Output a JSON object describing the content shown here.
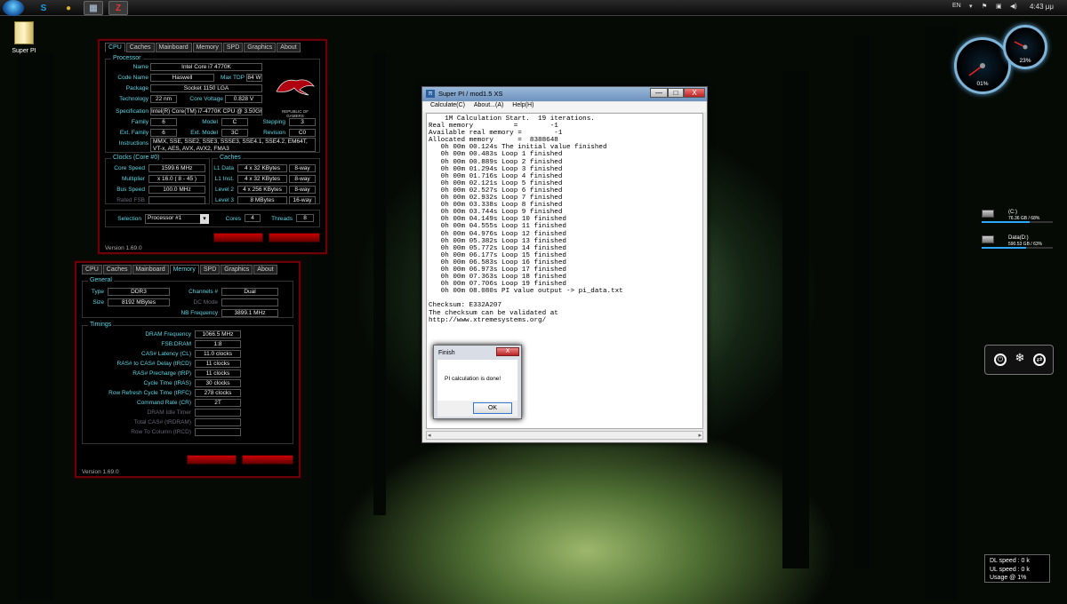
{
  "taskbar": {
    "lang": "EN",
    "clock": "4:43 μμ",
    "apps": [
      {
        "icon": "skype-icon",
        "glyph": "S",
        "color": "#1ba1e2"
      },
      {
        "icon": "chrome-icon",
        "glyph": "●",
        "color": "#e0b020"
      },
      {
        "icon": "cpuid-icon",
        "glyph": "▦",
        "color": "#9ab"
      },
      {
        "icon": "z-icon",
        "glyph": "Z",
        "color": "#e33"
      }
    ]
  },
  "desktop": {
    "icon_label": "Super PI"
  },
  "cpuz1": {
    "tabs": [
      "CPU",
      "Caches",
      "Mainboard",
      "Memory",
      "SPD",
      "Graphics",
      "About"
    ],
    "processor_title": "Processor",
    "name_label": "Name",
    "name": "Intel Core i7 4770K",
    "codename_label": "Code Name",
    "codename": "Haswell",
    "maxtdp_label": "Max TDP",
    "maxtdp": "84 W",
    "package_label": "Package",
    "package": "Socket 1150 LGA",
    "tech_label": "Technology",
    "tech": "22 nm",
    "voltage_label": "Core Voltage",
    "voltage": "0.828 V",
    "spec_label": "Specification",
    "spec": "Intel(R) Core(TM) i7-4770K CPU @ 3.50GHz",
    "family_label": "Family",
    "family": "6",
    "model_label": "Model",
    "model": "C",
    "stepping_label": "Stepping",
    "stepping": "3",
    "extfamily_label": "Ext. Family",
    "extfamily": "6",
    "extmodel_label": "Ext. Model",
    "extmodel": "3C",
    "revision_label": "Revision",
    "revision": "C0",
    "instr_label": "Instructions",
    "instr": "MMX, SSE, SSE2, SSE3, SSSE3, SSE4.1, SSE4.2, EM64T, VT-x, AES, AVX, AVX2, FMA3",
    "rog_text": "REPUBLIC OF GAMERS",
    "clocks_title": "Clocks (Core #0)",
    "corespeed_label": "Core Speed",
    "corespeed": "1599.6 MHz",
    "multiplier_label": "Multiplier",
    "multiplier": "x 16.0 ( 8 - 45 )",
    "busspeed_label": "Bus Speed",
    "busspeed": "100.0 MHz",
    "ratedfsb_label": "Rated FSB",
    "ratedfsb": "",
    "caches_title": "Caches",
    "l1d_label": "L1 Data",
    "l1d": "4 x 32 KBytes",
    "l1d_way": "8-way",
    "l1i_label": "L1 Inst.",
    "l1i": "4 x 32 KBytes",
    "l1i_way": "8-way",
    "l2_label": "Level 2",
    "l2": "4 x 256 KBytes",
    "l2_way": "8-way",
    "l3_label": "Level 3",
    "l3": "8 MBytes",
    "l3_way": "16-way",
    "selection_label": "Selection",
    "selection": "Processor #1",
    "cores_label": "Cores",
    "cores": "4",
    "threads_label": "Threads",
    "threads": "8",
    "version": "Version 1.69.0"
  },
  "cpuz2": {
    "tabs": [
      "CPU",
      "Caches",
      "Mainboard",
      "Memory",
      "SPD",
      "Graphics",
      "About"
    ],
    "general_title": "General",
    "type_label": "Type",
    "type": "DDR3",
    "channels_label": "Channels #",
    "channels": "Dual",
    "size_label": "Size",
    "size": "8192 MBytes",
    "dcmode_label": "DC Mode",
    "dcmode": "",
    "nbfreq_label": "NB Frequency",
    "nbfreq": "3899.1 MHz",
    "timings_title": "Timings",
    "timings": [
      {
        "label": "DRAM Frequency",
        "value": "1066.5 MHz"
      },
      {
        "label": "FSB:DRAM",
        "value": "1:8"
      },
      {
        "label": "CAS# Latency (CL)",
        "value": "11.0 clocks"
      },
      {
        "label": "RAS# to CAS# Delay (tRCD)",
        "value": "11 clocks"
      },
      {
        "label": "RAS# Precharge (tRP)",
        "value": "11 clocks"
      },
      {
        "label": "Cycle Time (tRAS)",
        "value": "30 clocks"
      },
      {
        "label": "Row Refresh Cycle Time (tRFC)",
        "value": "278 clocks"
      },
      {
        "label": "Command Rate (CR)",
        "value": "2T"
      },
      {
        "label": "DRAM Idle Timer",
        "value": ""
      },
      {
        "label": "Total CAS# (tRDRAM)",
        "value": ""
      },
      {
        "label": "Row To Column (tRCD)",
        "value": ""
      }
    ],
    "version": "Version 1.69.0"
  },
  "superpi": {
    "title": "Super PI / mod1.5 XS",
    "minimize": "—",
    "maximize": "□",
    "close": "X",
    "menu": [
      "Calculate(C)",
      "About...(A)",
      "Help(H)"
    ],
    "output": "    1M Calculation Start.  19 iterations.\nReal memory          =        -1\nAvailable real memory =        -1\nAllocated memory      =  8388648\n   0h 00m 00.124s The initial value finished\n   0h 00m 00.483s Loop 1 finished\n   0h 00m 00.889s Loop 2 finished\n   0h 00m 01.294s Loop 3 finished\n   0h 00m 01.716s Loop 4 finished\n   0h 00m 02.121s Loop 5 finished\n   0h 00m 02.527s Loop 6 finished\n   0h 00m 02.932s Loop 7 finished\n   0h 00m 03.338s Loop 8 finished\n   0h 00m 03.744s Loop 9 finished\n   0h 00m 04.149s Loop 10 finished\n   0h 00m 04.555s Loop 11 finished\n   0h 00m 04.976s Loop 12 finished\n   0h 00m 05.382s Loop 13 finished\n   0h 00m 05.772s Loop 14 finished\n   0h 00m 06.177s Loop 15 finished\n   0h 00m 06.583s Loop 16 finished\n   0h 00m 06.973s Loop 17 finished\n   0h 00m 07.363s Loop 18 finished\n   0h 00m 07.706s Loop 19 finished\n   0h 00m 08.080s PI value output -> pi_data.txt\n\nChecksum: E332A207\nThe checksum can be validated at\nhttp://www.xtremesystems.org/"
  },
  "dialog": {
    "title": "Finish",
    "close": "X",
    "message": "PI calculation is done!",
    "ok": "OK"
  },
  "gadgets": {
    "gauge_cpu": "01%",
    "gauge_mem": "23%",
    "drives": [
      {
        "name": "(C:)",
        "info": "76.36 GB / 68%",
        "fill": 0.68
      },
      {
        "name": "Data(D:)",
        "info": "590.53 GB / 63%",
        "fill": 0.63
      }
    ],
    "net_dl": "DL speed : 0 k",
    "net_ul": "UL speed : 0 k",
    "net_usage": "Usage @ 1%"
  },
  "colors": {
    "accent_cyan": "#5bd6e6",
    "rog_red": "#6a0008"
  }
}
